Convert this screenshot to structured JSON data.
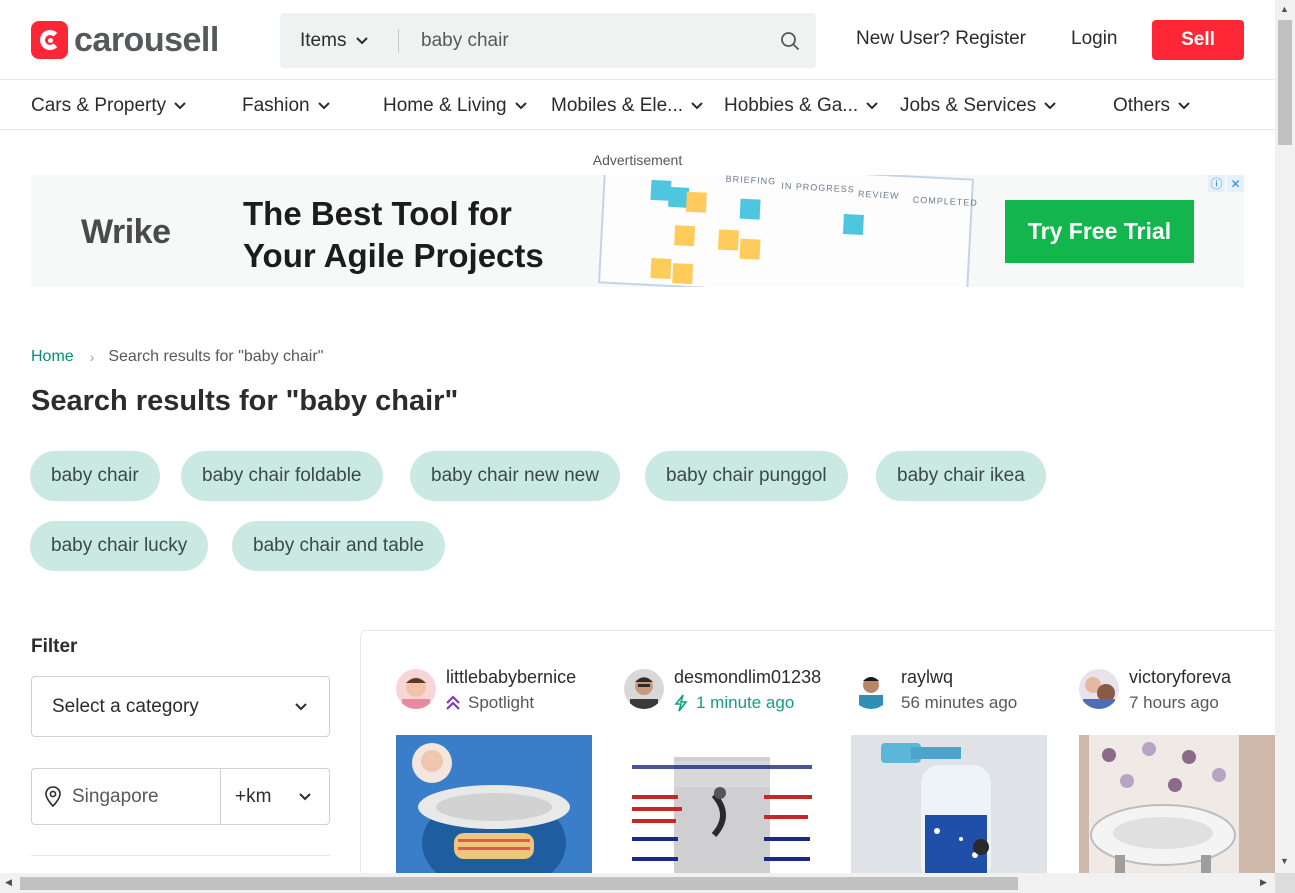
{
  "header": {
    "logo_text": "carousell",
    "search": {
      "category": "Items",
      "query": "baby chair"
    },
    "register_label": "New User? Register",
    "login_label": "Login",
    "sell_label": "Sell"
  },
  "categories": [
    {
      "label": "Cars & Property"
    },
    {
      "label": "Fashion"
    },
    {
      "label": "Home & Living"
    },
    {
      "label": "Mobiles & Ele..."
    },
    {
      "label": "Hobbies & Ga..."
    },
    {
      "label": "Jobs & Services"
    },
    {
      "label": "Others"
    }
  ],
  "ad": {
    "label": "Advertisement",
    "brand": "Wrike",
    "headline": [
      "The Best Tool for",
      "Your Agile Projects"
    ],
    "board_headers": [
      "BRIEFING",
      "IN PROGRESS",
      "REVIEW",
      "COMPLETED"
    ],
    "cta": "Try Free Trial",
    "accent": "#12b64c"
  },
  "breadcrumb": {
    "home": "Home",
    "current": "Search results for \"baby chair\""
  },
  "title": "Search results for \"baby chair\"",
  "suggestions": [
    "baby chair",
    "baby chair foldable",
    "baby chair new new",
    "baby chair punggol",
    "baby chair ikea",
    "baby chair lucky",
    "baby chair and table"
  ],
  "filter": {
    "title": "Filter",
    "category_placeholder": "Select a category",
    "location": "Singapore",
    "distance": "+km"
  },
  "listings": [
    {
      "seller": "littlebabybernice",
      "meta": "Spotlight",
      "meta_icon": "spotlight-icon"
    },
    {
      "seller": "desmondlim01238",
      "meta": "1 minute ago",
      "meta_icon": "bolt-icon"
    },
    {
      "seller": "raylwq",
      "meta": "56 minutes ago"
    },
    {
      "seller": "victoryforeva",
      "meta": "7 hours ago"
    }
  ],
  "colors": {
    "brand": "#ff2636",
    "link": "#008f79",
    "chip": "#cbe9e3"
  }
}
